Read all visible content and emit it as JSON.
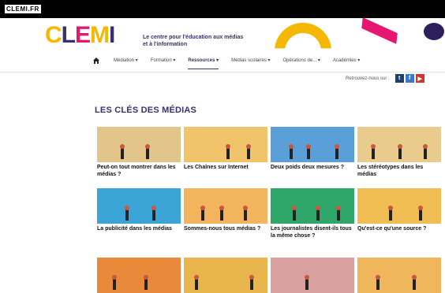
{
  "topbar": {
    "logo_text": "CLEMI.FR"
  },
  "brand": {
    "letters": [
      {
        "char": "C",
        "color": "#f6b700"
      },
      {
        "char": "L",
        "color": "#3d2d6e"
      },
      {
        "char": "E",
        "color": "#e6176f"
      },
      {
        "char": "M",
        "color": "#f6b700"
      },
      {
        "char": "I",
        "color": "#3d2d6e"
      }
    ],
    "tagline": "Le centre pour l'éducation aux médias et à l'information",
    "accent_colors": {
      "yellow": "#f6b700",
      "pink": "#e6176f",
      "purple": "#3d2d6e"
    }
  },
  "nav": {
    "home_icon": "home-icon",
    "items": [
      {
        "label": "Médiation ▾",
        "active": false
      },
      {
        "label": "Formation ▾",
        "active": false
      },
      {
        "label": "Ressources ▾",
        "active": true
      },
      {
        "label": "Médias scolaires ▾",
        "active": false
      },
      {
        "label": "Opérations de... ▾",
        "active": false
      },
      {
        "label": "Académies ▾",
        "active": false
      }
    ]
  },
  "follow": {
    "label": "Retrouvez-nous sur :",
    "icons": [
      {
        "name": "twitter-icon",
        "glyph": "t",
        "color": "#1d3f6e"
      },
      {
        "name": "facebook-icon",
        "glyph": "f",
        "color": "#3b78c6"
      },
      {
        "name": "youtube-icon",
        "glyph": "▶",
        "color": "#d0342c"
      }
    ]
  },
  "page": {
    "title": "LES CLÉS DES MÉDIAS"
  },
  "cards": [
    {
      "caption": "Peut-on tout montrer dans les médias ?",
      "bg": "#e2c58a"
    },
    {
      "caption": "Les Chaînes sur Internet",
      "bg": "#f1c36a"
    },
    {
      "caption": "Deux poids deux mesures ?",
      "bg": "#5a9fd8"
    },
    {
      "caption": "Les stéréotypes dans les médias",
      "bg": "#eacb8e"
    },
    {
      "caption": "La publicité dans les médias",
      "bg": "#3aa4d6"
    },
    {
      "caption": "Sommes-nous tous médias ?",
      "bg": "#f2b45c"
    },
    {
      "caption": "Les journalistes disent-ils tous la même chose ?",
      "bg": "#2fa66a"
    },
    {
      "caption": "Qu'est-ce qu'une source ?",
      "bg": "#f0bd52"
    },
    {
      "caption": "",
      "bg": "#e98a3a"
    },
    {
      "caption": "",
      "bg": "#e9b64e"
    },
    {
      "caption": "",
      "bg": "#d9a0a0"
    },
    {
      "caption": "",
      "bg": "#efb65b"
    }
  ]
}
